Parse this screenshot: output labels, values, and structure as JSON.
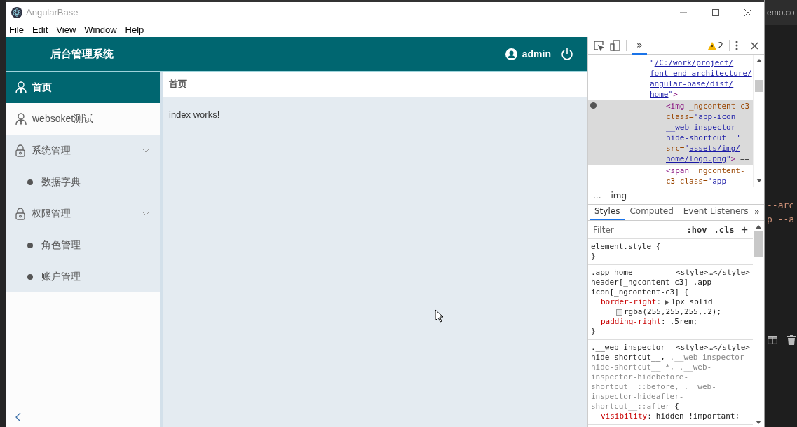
{
  "window": {
    "title": "AngularBase"
  },
  "menu": [
    "File",
    "Edit",
    "View",
    "Window",
    "Help"
  ],
  "app": {
    "title": "后台管理系统",
    "user": "admin"
  },
  "sidebar": {
    "items": [
      {
        "label": "首页",
        "kind": "page",
        "selected": true
      },
      {
        "label": "websoket测试",
        "kind": "page",
        "selected": false
      },
      {
        "label": "系统管理",
        "kind": "group",
        "expanded": true,
        "children": [
          {
            "label": "数据字典",
            "selected": false
          }
        ]
      },
      {
        "label": "权限管理",
        "kind": "group",
        "expanded": true,
        "children": [
          {
            "label": "角色管理",
            "selected": false
          },
          {
            "label": "账户管理",
            "selected": false
          }
        ]
      }
    ]
  },
  "breadcrumb": "首页",
  "content": {
    "text": "index works!"
  },
  "devtools": {
    "panel_tab": {
      "label": "»",
      "selected": true
    },
    "warnings": "2",
    "nodes": [
      {
        "kind": "attribute-tail",
        "selected": false,
        "lines": [
          [
            {
              "text": "\"",
              "kind": "value"
            },
            {
              "text": "/C:/work/project/",
              "kind": "link"
            }
          ],
          [
            {
              "text": "font-end-architecture/",
              "kind": "link"
            }
          ],
          [
            {
              "text": "angular-base/dist/",
              "kind": "link"
            }
          ],
          [
            {
              "text": "home",
              "kind": "link"
            },
            {
              "text": "\"",
              "kind": "value"
            },
            {
              "text": ">",
              "kind": "tag"
            }
          ]
        ]
      },
      {
        "kind": "element",
        "selected": true,
        "lines": [
          [
            {
              "text": "<img",
              "kind": "tag"
            },
            {
              "text": " _ngcontent-c3",
              "kind": "attr"
            }
          ],
          [
            {
              "text": "class=",
              "kind": "attr"
            },
            {
              "text": "\"app-icon",
              "kind": "value"
            }
          ],
          [
            {
              "text": "__web-inspector-",
              "kind": "value"
            }
          ],
          [
            {
              "text": "hide-shortcut__\"",
              "kind": "value"
            }
          ],
          [
            {
              "text": "src=",
              "kind": "attr"
            },
            {
              "text": "\"",
              "kind": "value"
            },
            {
              "text": "assets/img/",
              "kind": "link"
            }
          ],
          [
            {
              "text": "home/logo.png",
              "kind": "link"
            },
            {
              "text": "\"",
              "kind": "value"
            },
            {
              "text": ">",
              "kind": "tag"
            },
            {
              "text": " ==",
              "kind": "text"
            }
          ]
        ]
      },
      {
        "kind": "element",
        "selected": false,
        "lines": [
          [
            {
              "text": "<span",
              "kind": "tag"
            },
            {
              "text": " _ngcontent-",
              "kind": "attr"
            }
          ],
          [
            {
              "text": "c3 class=",
              "kind": "attr"
            },
            {
              "text": "\"app-",
              "kind": "value"
            }
          ]
        ]
      }
    ],
    "path": [
      "...",
      "img"
    ],
    "tabs": [
      {
        "label": "Styles",
        "selected": true
      },
      {
        "label": "Computed",
        "selected": false
      },
      {
        "label": "Event Listeners",
        "selected": false
      }
    ],
    "more_tabs": "»",
    "filter": {
      "placeholder": "Filter"
    },
    "buttons": [
      ":hov",
      ".cls",
      "+"
    ],
    "rules": [
      {
        "selector": [
          [
            {
              "text": "element.style {",
              "kind": "matched"
            }
          ]
        ],
        "closing": "}"
      },
      {
        "source": "<style>…</style>",
        "selector": [
          [
            {
              "text": ".app-home-",
              "kind": "matched"
            }
          ],
          [
            {
              "text": "header[_ngcontent-c3] .app-",
              "kind": "matched"
            }
          ],
          [
            {
              "text": "icon[_ngcontent-c3] {",
              "kind": "matched"
            }
          ]
        ],
        "declarations": [
          {
            "property": "border-right",
            "separator": ":",
            "expander": true,
            "value": "1px solid",
            "continuation": "rgba(255,255,255,.2);",
            "swatch": true
          },
          {
            "property": "padding-right",
            "separator": ":",
            "expander": false,
            "value": ".5rem;"
          }
        ],
        "closing": "}"
      },
      {
        "source": "<style>…</style>",
        "selector": [
          [
            {
              "text": ".__web-inspector-",
              "kind": "matched"
            }
          ],
          [
            {
              "text": "hide-shortcut__, ",
              "kind": "matched"
            },
            {
              "text": ".__web-inspector-",
              "kind": "unmatched"
            }
          ],
          [
            {
              "text": "hide-shortcut__ *, .__web-",
              "kind": "unmatched"
            }
          ],
          [
            {
              "text": "inspector-hidebefore-",
              "kind": "unmatched"
            }
          ],
          [
            {
              "text": "shortcut__::before, .__web-",
              "kind": "unmatched"
            }
          ],
          [
            {
              "text": "inspector-hideafter-",
              "kind": "unmatched"
            }
          ],
          [
            {
              "text": "shortcut__::after ",
              "kind": "unmatched"
            },
            {
              "text": "{",
              "kind": "matched"
            }
          ]
        ],
        "declarations": [
          {
            "property": "visibility",
            "separator": ":",
            "expander": false,
            "value": "hidden !important;"
          }
        ]
      }
    ]
  },
  "background": {
    "texts": [
      "emo.co",
      "--arc",
      "p --a"
    ]
  }
}
